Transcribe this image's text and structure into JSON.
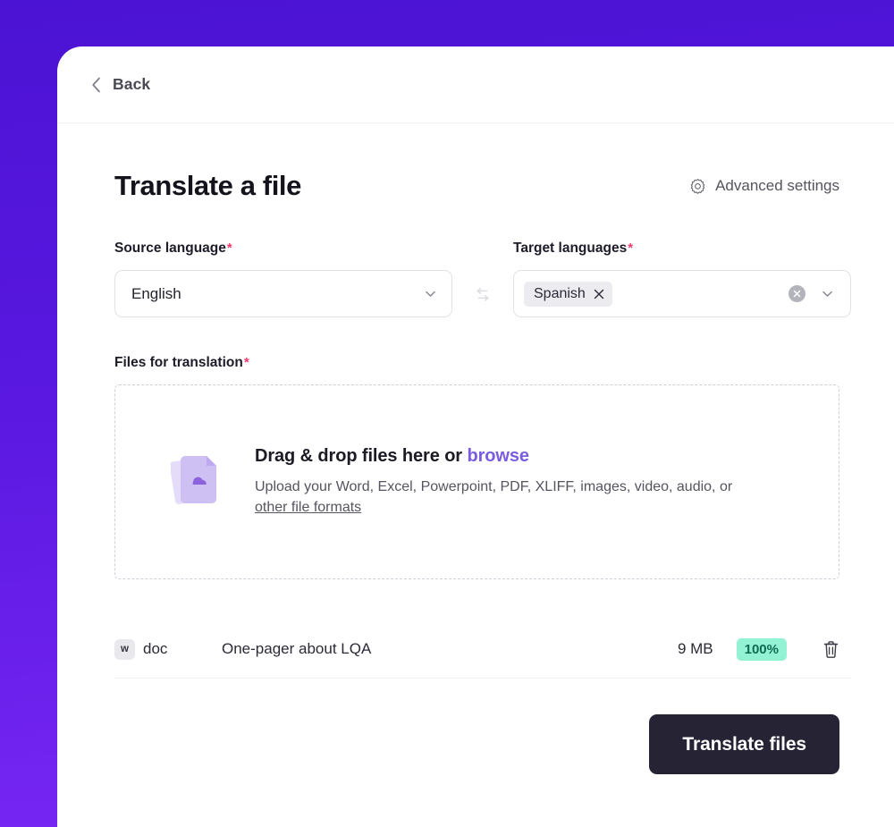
{
  "theme": {
    "bg_gradient_top": "#4B13D4",
    "bg_gradient_bottom": "#7A28F5",
    "accent_link": "#7b5ce0",
    "required_star": "#ef3a6d",
    "badge_bg": "#93f1d4",
    "badge_text": "#0f6b51",
    "primary_button_bg": "#262335"
  },
  "header": {
    "back_label": "Back",
    "back_icon": "chevron-left-icon"
  },
  "main": {
    "title": "Translate a file",
    "advanced_settings": {
      "label": "Advanced settings",
      "icon": "gear-icon"
    },
    "source_language": {
      "label": "Source language",
      "required_marker": "*",
      "value": "English",
      "chevron_icon": "chevron-down-icon"
    },
    "swap": {
      "icon": "swap-arrows-icon"
    },
    "target_languages": {
      "label": "Target languages",
      "required_marker": "*",
      "chips": [
        {
          "label": "Spanish",
          "remove_icon": "close-x-icon"
        }
      ],
      "clear_icon": "clear-circle-icon",
      "chevron_icon": "chevron-down-icon"
    },
    "files_for_translation": {
      "label": "Files for translation",
      "required_marker": "*",
      "dropzone": {
        "illustration": "stacked-documents-icon",
        "headline_prefix": "Drag & drop files here or ",
        "browse_label": "browse",
        "subtext": "Upload your Word, Excel, Powerpoint, PDF, XLIFF, images, video, audio, or ",
        "formats_link_label": "other file formats"
      }
    },
    "file_list": {
      "rows": [
        {
          "type_badge": "w",
          "extension": "doc",
          "name": "One-pager about LQA",
          "size": "9 MB",
          "progress": "100%",
          "delete_icon": "trash-icon"
        }
      ]
    },
    "submit_button": {
      "label": "Translate files"
    }
  }
}
